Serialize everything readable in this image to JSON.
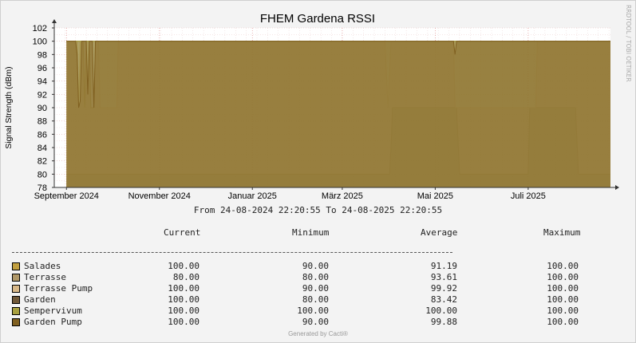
{
  "chart_data": {
    "type": "area",
    "title": "FHEM Gardena RSSI",
    "ylabel": "Signal Strength (dBm)",
    "xlabel": "",
    "ylim": [
      78,
      102
    ],
    "xlim": [
      "2024-08-24",
      "2025-08-24"
    ],
    "y_ticks": [
      78,
      80,
      82,
      84,
      86,
      88,
      90,
      92,
      94,
      96,
      98,
      100,
      102
    ],
    "x_ticks": [
      {
        "label": "September 2024",
        "date": "2024-09-01"
      },
      {
        "label": "November 2024",
        "date": "2024-11-01"
      },
      {
        "label": "Januar 2025",
        "date": "2025-01-01"
      },
      {
        "label": "März 2025",
        "date": "2025-03-01"
      },
      {
        "label": "Mai 2025",
        "date": "2025-05-01"
      },
      {
        "label": "Juli 2025",
        "date": "2025-07-01"
      }
    ],
    "grid": true,
    "data_start": "2024-09-01",
    "series": [
      {
        "name": "Salades",
        "color": "#C2A040",
        "points": [
          [
            "2024-09-01",
            100
          ],
          [
            "2024-09-08",
            100
          ],
          [
            "2024-09-09",
            90
          ],
          [
            "2024-09-10",
            100
          ],
          [
            "2024-09-12",
            100
          ],
          [
            "2024-09-13",
            90
          ],
          [
            "2024-09-14",
            100
          ],
          [
            "2024-09-16",
            100
          ],
          [
            "2024-09-17",
            90
          ],
          [
            "2024-09-19",
            90
          ],
          [
            "2024-09-20",
            100
          ],
          [
            "2025-08-24",
            100
          ]
        ]
      },
      {
        "name": "Terrasse",
        "color": "#B09868",
        "points": [
          [
            "2024-09-01",
            80
          ],
          [
            "2025-04-01",
            80
          ],
          [
            "2025-04-02",
            84
          ],
          [
            "2025-04-03",
            90
          ],
          [
            "2025-05-15",
            90
          ],
          [
            "2025-05-17",
            80
          ],
          [
            "2025-07-01",
            80
          ],
          [
            "2025-07-02",
            90
          ],
          [
            "2025-08-01",
            90
          ],
          [
            "2025-08-03",
            80
          ],
          [
            "2025-08-24",
            80
          ]
        ]
      },
      {
        "name": "Terrasse Pump",
        "color": "#D8B888",
        "points": [
          [
            "2024-09-01",
            100
          ],
          [
            "2024-09-22",
            100
          ],
          [
            "2024-09-23",
            90
          ],
          [
            "2024-10-04",
            90
          ],
          [
            "2024-10-05",
            100
          ],
          [
            "2025-03-29",
            100
          ],
          [
            "2025-03-31",
            90
          ],
          [
            "2025-04-02",
            100
          ],
          [
            "2025-05-13",
            100
          ],
          [
            "2025-05-14",
            90
          ],
          [
            "2025-07-06",
            90
          ],
          [
            "2025-07-07",
            100
          ],
          [
            "2025-08-24",
            100
          ]
        ]
      },
      {
        "name": "Garden",
        "color": "#705838",
        "points": [
          [
            "2024-09-01",
            100
          ],
          [
            "2025-08-24",
            100
          ]
        ]
      },
      {
        "name": "Sempervivum",
        "color": "#A8A040",
        "points": [
          [
            "2024-09-01",
            100
          ],
          [
            "2025-08-24",
            100
          ]
        ]
      },
      {
        "name": "Garden Pump",
        "color": "#806020",
        "points": [
          [
            "2024-09-01",
            100
          ],
          [
            "2024-09-07",
            100
          ],
          [
            "2024-09-08",
            98
          ],
          [
            "2024-09-09",
            90
          ],
          [
            "2024-09-10",
            91
          ],
          [
            "2024-09-11",
            100
          ],
          [
            "2024-09-14",
            100
          ],
          [
            "2024-09-15",
            92
          ],
          [
            "2024-09-16",
            100
          ],
          [
            "2024-09-18",
            100
          ],
          [
            "2024-09-19",
            90
          ],
          [
            "2024-09-20",
            100
          ],
          [
            "2025-05-13",
            100
          ],
          [
            "2025-05-14",
            98
          ],
          [
            "2025-05-15",
            100
          ],
          [
            "2025-08-24",
            100
          ]
        ]
      }
    ]
  },
  "watermark": "RRDTOOL / TOBI OETIKER",
  "range_text": "From 24-08-2024 22:20:55 To 24-08-2025 22:20:55",
  "legend": {
    "headers": {
      "current": "Current",
      "minimum": "Minimum",
      "average": "Average",
      "maximum": "Maximum"
    },
    "rule": "--------------------------------------------------------------------------------",
    "rows": [
      {
        "name": "Salades",
        "color": "#C2A040",
        "current": "100.00",
        "minimum": "90.00",
        "average": "91.19",
        "maximum": "100.00"
      },
      {
        "name": "Terrasse",
        "color": "#B09868",
        "current": "80.00",
        "minimum": "80.00",
        "average": "93.61",
        "maximum": "100.00"
      },
      {
        "name": "Terrasse Pump",
        "color": "#D8B888",
        "current": "100.00",
        "minimum": "90.00",
        "average": "99.92",
        "maximum": "100.00"
      },
      {
        "name": "Garden",
        "color": "#705838",
        "current": "100.00",
        "minimum": "80.00",
        "average": "83.42",
        "maximum": "100.00"
      },
      {
        "name": "Sempervivum",
        "color": "#A8A040",
        "current": "100.00",
        "minimum": "100.00",
        "average": "100.00",
        "maximum": "100.00"
      },
      {
        "name": "Garden Pump",
        "color": "#806020",
        "current": "100.00",
        "minimum": "90.00",
        "average": "99.88",
        "maximum": "100.00"
      }
    ]
  },
  "footer": "Generated by Cacti®"
}
